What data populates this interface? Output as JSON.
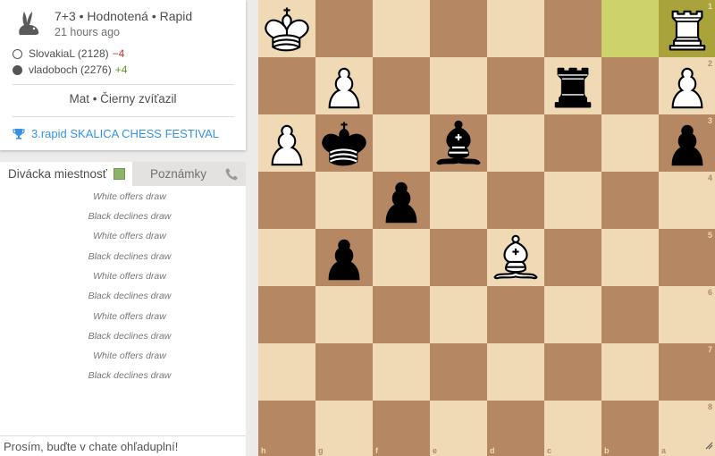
{
  "game": {
    "title": "7+3 • Hodnotená • Rapid",
    "time_ago": "21 hours ago",
    "speed_icon": "rabbit-icon"
  },
  "players": [
    {
      "name": "SlovakiaL (2128)",
      "diff": "−4",
      "color": "white"
    },
    {
      "name": "vladoboch (2276)",
      "diff": "+4",
      "color": "black"
    }
  ],
  "status": "Mat • Čierny zvíťazil",
  "tournament": {
    "icon": "trophy-icon",
    "name": "3.rapid SKALICA CHESS FESTIVAL"
  },
  "chat": {
    "tab_chat": "Divácka miestnosť",
    "tab_notes": "Poznámky",
    "messages": [
      "White offers draw",
      "Black declines draw",
      "White offers draw",
      "Black declines draw",
      "White offers draw",
      "Black declines draw",
      "White offers draw",
      "Black declines draw",
      "White offers draw",
      "Black declines draw"
    ],
    "placeholder": "Prosím, buďte v chate ohľaduplní!"
  },
  "board": {
    "orientation": "black",
    "files_labels": [
      "h",
      "g",
      "f",
      "e",
      "d",
      "c",
      "b",
      "a"
    ],
    "rank_labels": [
      "1",
      "2",
      "3",
      "4",
      "5",
      "6",
      "7",
      "8"
    ],
    "colors": {
      "light": "#f0d9b5",
      "dark": "#b58863",
      "highlight": "#cdd26a"
    },
    "last_move": [
      "b1",
      "a1"
    ],
    "pieces": [
      {
        "square": "h1",
        "piece": "white-king"
      },
      {
        "square": "a1",
        "piece": "white-rook"
      },
      {
        "square": "g2",
        "piece": "white-pawn"
      },
      {
        "square": "c2",
        "piece": "black-rook"
      },
      {
        "square": "a2",
        "piece": "white-pawn"
      },
      {
        "square": "h3",
        "piece": "white-pawn"
      },
      {
        "square": "g3",
        "piece": "black-king"
      },
      {
        "square": "e3",
        "piece": "black-bishop"
      },
      {
        "square": "a3",
        "piece": "black-pawn"
      },
      {
        "square": "f4",
        "piece": "black-pawn"
      },
      {
        "square": "g5",
        "piece": "black-pawn"
      },
      {
        "square": "d5",
        "piece": "white-bishop"
      }
    ]
  }
}
